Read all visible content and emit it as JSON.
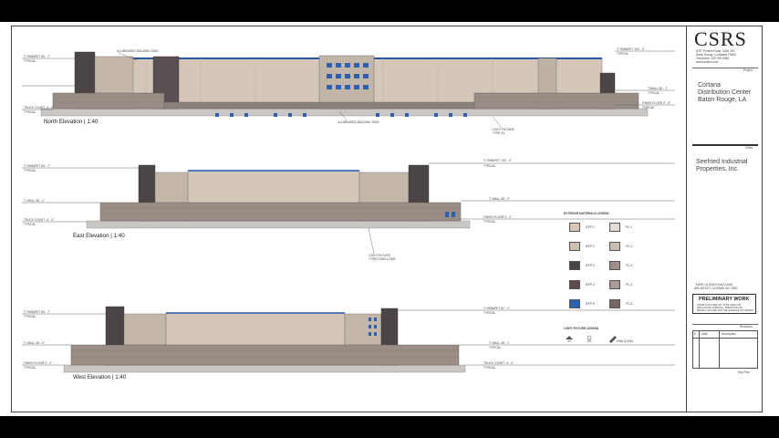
{
  "firm": {
    "logo": "CSRS",
    "address_line1": "6767 Perkins Road, Suite 200",
    "address_line2": "Baton Rouge, Louisiana 70808",
    "phone": "Telephone: 225 769-0546",
    "website": "www.csrsinc.com"
  },
  "project": {
    "label": "Project",
    "name_line1": "Cortana",
    "name_line2": "Distribution Center",
    "name_line3": "Baton Rouge, LA"
  },
  "client": {
    "label": "Client",
    "name_line1": "Seefried Industrial",
    "name_line2": "Properties, Inc."
  },
  "architect": {
    "line1": "MARY ALISON HOAGLAND",
    "line2": "ARCHITECT, LICENSE NO. 9301"
  },
  "stamp": {
    "title": "PRELIMINARY WORK",
    "note1": "THESE PLANS ARE NOT TO BE USED FOR",
    "note2": "REGULATORY APPROVAL, PERMITTING OR",
    "note3": "BIDDING, OR USED FOR THE ISSUANCE OF A PERMIT"
  },
  "revisions": {
    "title": "Revisions",
    "col_num": "#",
    "col_date": "Date",
    "col_desc": "Description",
    "key_plan": "Key Plan"
  },
  "north": {
    "title": "North Elevation  |  1:40",
    "sign_top": "ILLUMINATED BUILDING SIGN",
    "sign_bottom": "ILLUMINATED BUILDING SIGN",
    "light": "LIGHT FIXTURE\nTYPE XX",
    "left_parapet": "T/ PARAPET  84' - 7\"",
    "left_parapet_sub": "TYPICAL",
    "left_truck": "TRUCK COURT  -4' - 0\"",
    "left_truck_sub": "TYPICAL",
    "right_parapet": "T/ PARAPET  100' - 0\"",
    "right_parapet_sub": "TYPICAL",
    "right_wall": "T/WALL  38' - 1\"",
    "right_wall_sub": "TYPICAL",
    "right_floor": "FINISH FLOOR  0' - 0\"",
    "right_floor_sub": "TYPICAL"
  },
  "east": {
    "title": "East Elevation  |  1:40",
    "light": "LIGHT FIXTURE\nTYPES DW5 & DW3",
    "left_parapet": "T/ PARAPET  84' - 7\"",
    "left_parapet_sub": "TYPICAL",
    "left_wall": "T/ WALL  38' - 1\"",
    "left_truck": "TRUCK COURT  -4' - 0\"",
    "left_truck_sub": "TYPICAL",
    "right_parapet": "T/ PARAPET  100' - 0\"",
    "right_parapet_sub": "TYPICAL",
    "right_wall": "T/ WALL  38' - 0\"",
    "right_floor": "FINISH FLOOR  0' - 0\"",
    "right_floor_sub": "TYPICAL"
  },
  "west": {
    "title": "West Elevation  |  1:40",
    "left_parapet": "T/ PARAPET  84' - 7\"",
    "left_parapet_sub": "TYPICAL",
    "left_wall": "T/ WALL  38' - 0\"",
    "left_floor": "FINISH FLOOR  0' - 0\"",
    "left_floor_sub": "TYPICAL",
    "right_parapet": "T/ PARAPET  87' - 1\"",
    "right_parapet_sub": "TYPICAL",
    "right_wall": "T/ WALL  38' - 1\"",
    "right_wall_sub": "TYPICAL",
    "right_truck": "TRUCK COURT  -4' - 0\"",
    "right_truck_sub": "TYPICAL"
  },
  "legend": {
    "title": "EXTERIOR MATERIALS LEGEND",
    "left": [
      {
        "code": "EIFP-1",
        "color": "#d9c8b8"
      },
      {
        "code": "EIFP-2",
        "color": "#cdbfae"
      },
      {
        "code": "EIFP-3",
        "color": "#4a4446"
      },
      {
        "code": "EIFP-4",
        "color": "#5a4a48"
      },
      {
        "code": "EIFP-5",
        "color": "#2f5fb0"
      }
    ],
    "right": [
      {
        "code": "PC-1",
        "color": "#e4dcd2"
      },
      {
        "code": "PC-2",
        "color": "#cbbcb0"
      },
      {
        "code": "PC-3",
        "color": "#9e8e85"
      },
      {
        "code": "PC-4",
        "color": "#a89a92"
      },
      {
        "code": "PC-5",
        "color": "#7a6864"
      }
    ],
    "fixture_title": "LIGHT FIXTURE LEGEND",
    "fixture_1": "XX",
    "fixture_2": "DS",
    "fixture_3": "DW5 & DW3"
  }
}
